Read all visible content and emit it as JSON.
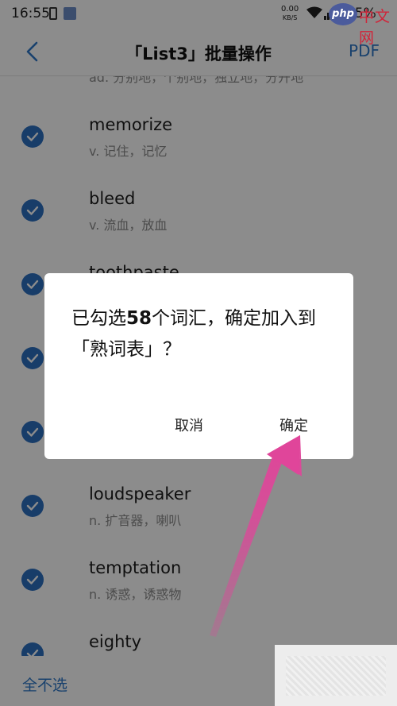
{
  "status_bar": {
    "time": "16:55",
    "net_speed_value": "0.00",
    "net_speed_unit": "KB/S",
    "battery_text": "35%"
  },
  "watermark": {
    "logo_text": "php",
    "site_text": "中文网"
  },
  "header": {
    "title": "「List3」批量操作",
    "pdf_label": "PDF"
  },
  "words": [
    {
      "word": "",
      "definition": "ad. 分别地，个别地，独立地，分开地",
      "checked": true
    },
    {
      "word": "memorize",
      "definition": "v. 记住，记忆",
      "checked": true
    },
    {
      "word": "bleed",
      "definition": "v. 流血，放血",
      "checked": true
    },
    {
      "word": "toothpaste",
      "definition": "",
      "checked": true
    },
    {
      "word": "",
      "definition": "",
      "checked": true
    },
    {
      "word": "",
      "definition": "",
      "checked": true
    },
    {
      "word": "loudspeaker",
      "definition": "n. 扩音器，喇叭",
      "checked": true
    },
    {
      "word": "temptation",
      "definition": "n. 诱惑，诱惑物",
      "checked": true
    },
    {
      "word": "eighty",
      "definition": "",
      "checked": true
    }
  ],
  "bottom_bar": {
    "select_none_label": "全不选"
  },
  "dialog": {
    "message_before": "已勾选",
    "count": "58",
    "message_after": "个词汇，确定加入到「熟词表」？",
    "cancel_label": "取消",
    "confirm_label": "确定"
  },
  "colors": {
    "accent": "#2e77c6",
    "check": "#2d6fc0",
    "arrow": "#e0459a",
    "overlay": "rgba(0,0,0,0.45)"
  }
}
